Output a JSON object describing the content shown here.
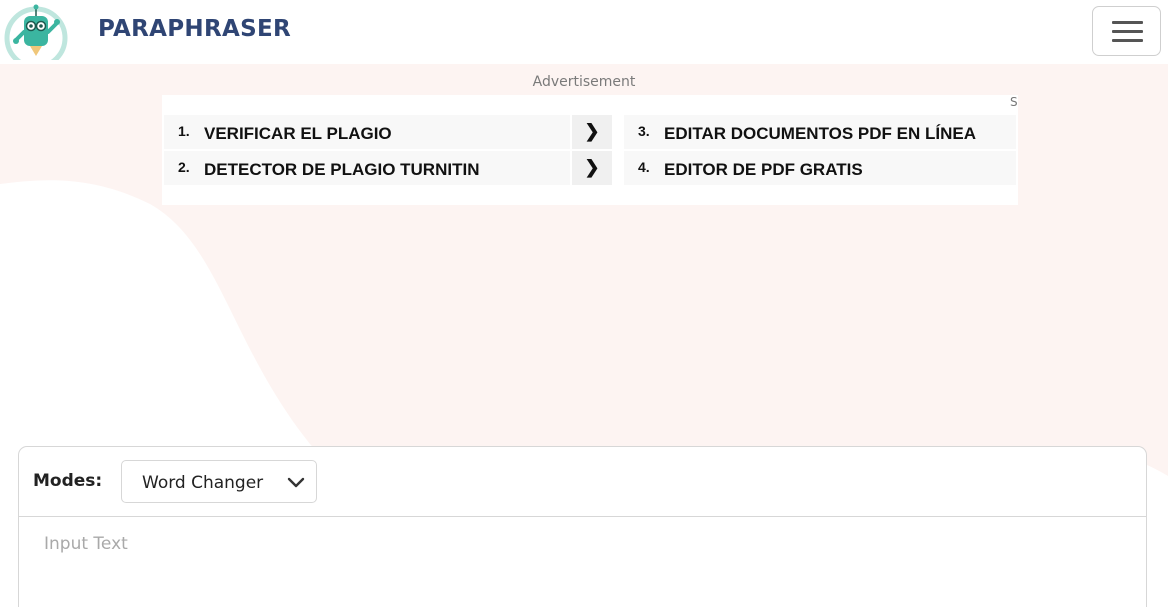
{
  "header": {
    "brand": "PARAPHRASER",
    "logo_icon": "robot-pencil-logo",
    "menu_icon": "hamburger-menu-icon"
  },
  "ad": {
    "label": "Advertisement",
    "corner_mark": "S",
    "items": [
      {
        "num": "1.",
        "text": "VERIFICAR EL PLAGIO"
      },
      {
        "num": "2.",
        "text": "DETECTOR DE PLAGIO TURNITIN"
      },
      {
        "num": "3.",
        "text": "EDITAR DOCUMENTOS PDF EN LÍNEA"
      },
      {
        "num": "4.",
        "text": "EDITOR DE PDF GRATIS"
      }
    ],
    "arrow_glyph": "❯"
  },
  "tool": {
    "modes_label": "Modes:",
    "mode_value": "Word Changer",
    "input_placeholder": "Input Text"
  },
  "colors": {
    "brand": "#2f4574",
    "background_blob": "#fdf4f2",
    "logo_accent": "#3bb5a0"
  }
}
